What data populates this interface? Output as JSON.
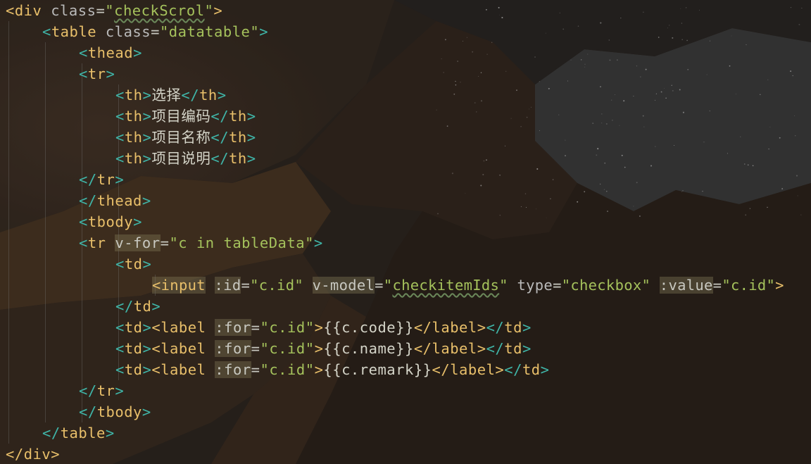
{
  "editor": {
    "lines": [
      {
        "id": "l1",
        "parts": [
          "<",
          "div",
          " ",
          "class",
          "=",
          "\"",
          "checkScrol",
          "\"",
          ">"
        ]
      },
      {
        "id": "l2",
        "parts": [
          "<",
          "table",
          " ",
          "class",
          "=",
          "\"datatable\"",
          ">"
        ]
      },
      {
        "id": "l3",
        "parts": [
          "<",
          "thead",
          ">"
        ]
      },
      {
        "id": "l4",
        "parts": [
          "<",
          "tr",
          ">"
        ]
      },
      {
        "id": "l5",
        "parts": [
          "<",
          "th",
          ">",
          "选择",
          "</",
          "th",
          ">"
        ]
      },
      {
        "id": "l6",
        "parts": [
          "<",
          "th",
          ">",
          "项目编码",
          "</",
          "th",
          ">"
        ]
      },
      {
        "id": "l7",
        "parts": [
          "<",
          "th",
          ">",
          "项目名称",
          "</",
          "th",
          ">"
        ]
      },
      {
        "id": "l8",
        "parts": [
          "<",
          "th",
          ">",
          "项目说明",
          "</",
          "th",
          ">"
        ]
      },
      {
        "id": "l9",
        "parts": [
          "</",
          "tr",
          ">"
        ]
      },
      {
        "id": "l10",
        "parts": [
          "</",
          "thead",
          ">"
        ]
      },
      {
        "id": "l11",
        "parts": [
          "<",
          "tbody",
          ">"
        ]
      },
      {
        "id": "l12",
        "parts": [
          "<",
          "tr",
          " ",
          "v-for",
          "=",
          "\"c in tableData\"",
          ">"
        ]
      },
      {
        "id": "l13",
        "parts": [
          "<",
          "td",
          ">"
        ]
      },
      {
        "id": "l14",
        "parts": [
          "<",
          "input",
          " ",
          ":id",
          "=",
          "\"c.id\"",
          " ",
          "v-model",
          "=",
          "\"",
          "checkitemIds",
          "\"",
          " ",
          "type",
          "=",
          "\"checkbox\"",
          " ",
          ":value",
          "=",
          "\"c.id\"",
          ">"
        ]
      },
      {
        "id": "l15",
        "parts": [
          "</",
          "td",
          ">"
        ]
      },
      {
        "id": "l16",
        "parts": [
          "<",
          "td",
          ">",
          "<",
          "label",
          " ",
          ":for",
          "=",
          "\"c.id\"",
          ">",
          "{{c.code}}",
          "</",
          "label",
          ">",
          "</",
          "td",
          ">"
        ]
      },
      {
        "id": "l17",
        "parts": [
          "<",
          "td",
          ">",
          "<",
          "label",
          " ",
          ":for",
          "=",
          "\"c.id\"",
          ">",
          "{{c.name}}",
          "</",
          "label",
          ">",
          "</",
          "td",
          ">"
        ]
      },
      {
        "id": "l18",
        "parts": [
          "<",
          "td",
          ">",
          "<",
          "label",
          " ",
          ":for",
          "=",
          "\"c.id\"",
          ">",
          "{{c.remark}}",
          "</",
          "label",
          ">",
          "</",
          "td",
          ">"
        ]
      },
      {
        "id": "l19",
        "parts": [
          "</",
          "tr",
          ">"
        ]
      },
      {
        "id": "l20",
        "parts": [
          "</",
          "tbody",
          ">"
        ]
      },
      {
        "id": "l21",
        "parts": [
          "</",
          "table",
          ">"
        ]
      },
      {
        "id": "l22",
        "parts": [
          "</",
          "div",
          ">"
        ]
      }
    ]
  },
  "colors": {
    "tag": "#e8bf6a",
    "bracket_teal": "#3fb5a8",
    "string": "#a5c25c",
    "attribute": "#bababa",
    "text": "#d4d4c8",
    "background": "#2b2b2b"
  }
}
